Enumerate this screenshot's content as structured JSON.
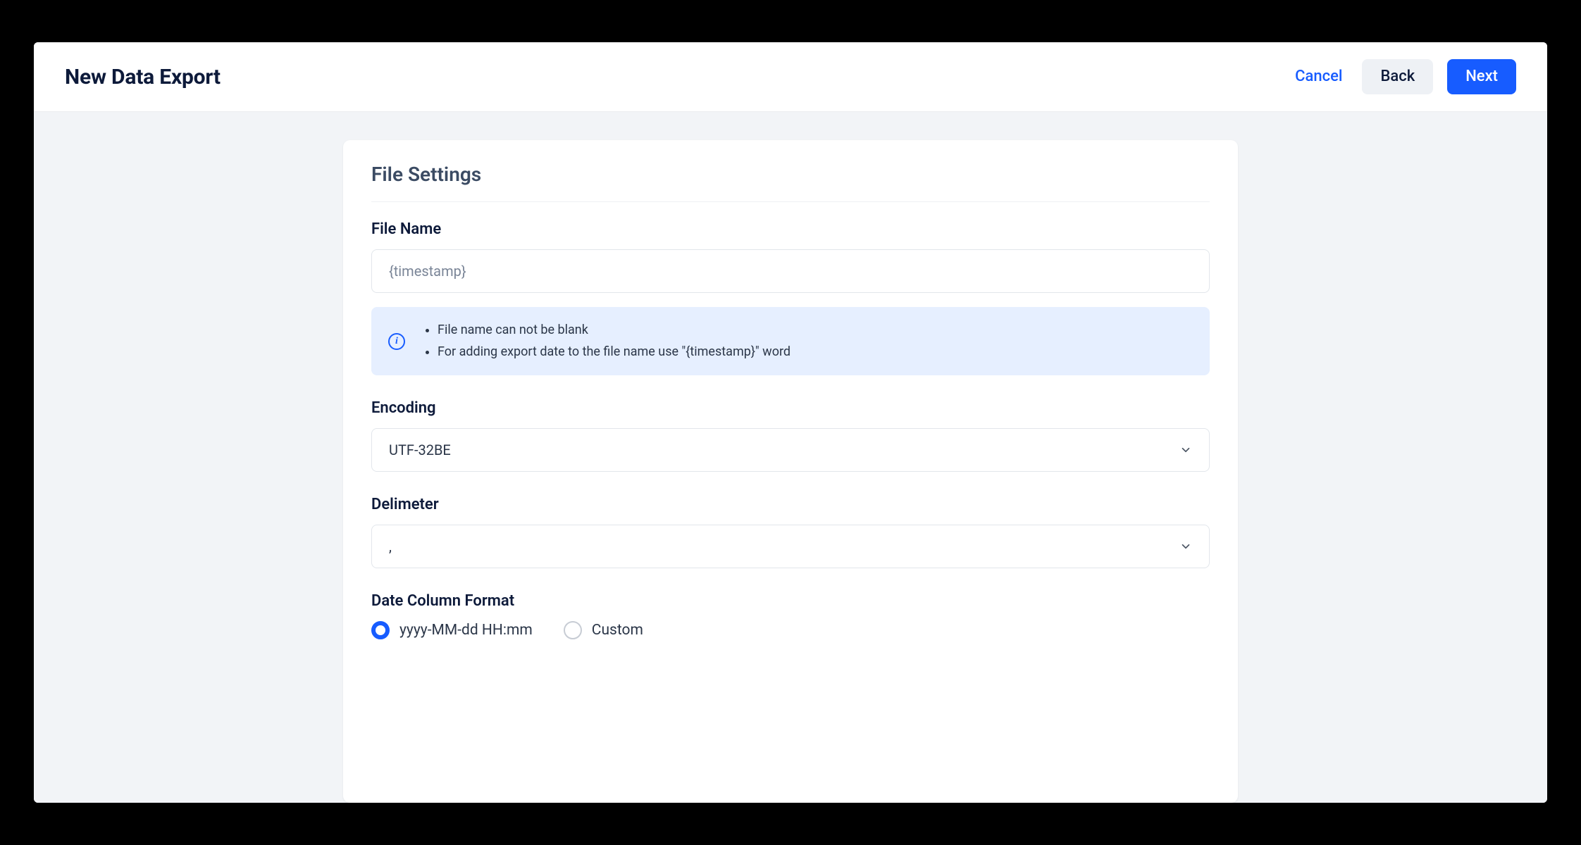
{
  "header": {
    "title": "New Data Export",
    "cancel": "Cancel",
    "back": "Back",
    "next": "Next"
  },
  "card": {
    "title": "File Settings",
    "fileName": {
      "label": "File Name",
      "value": "{timestamp}",
      "info": {
        "line1": "File name can not be blank",
        "line2": "For adding export date to the file name use \"{timestamp}\" word"
      }
    },
    "encoding": {
      "label": "Encoding",
      "value": "UTF-32BE"
    },
    "delimeter": {
      "label": "Delimeter",
      "value": ","
    },
    "dateFormat": {
      "label": "Date Column Format",
      "options": {
        "default": "yyyy-MM-dd HH:mm",
        "custom": "Custom"
      },
      "selected": "default"
    }
  }
}
